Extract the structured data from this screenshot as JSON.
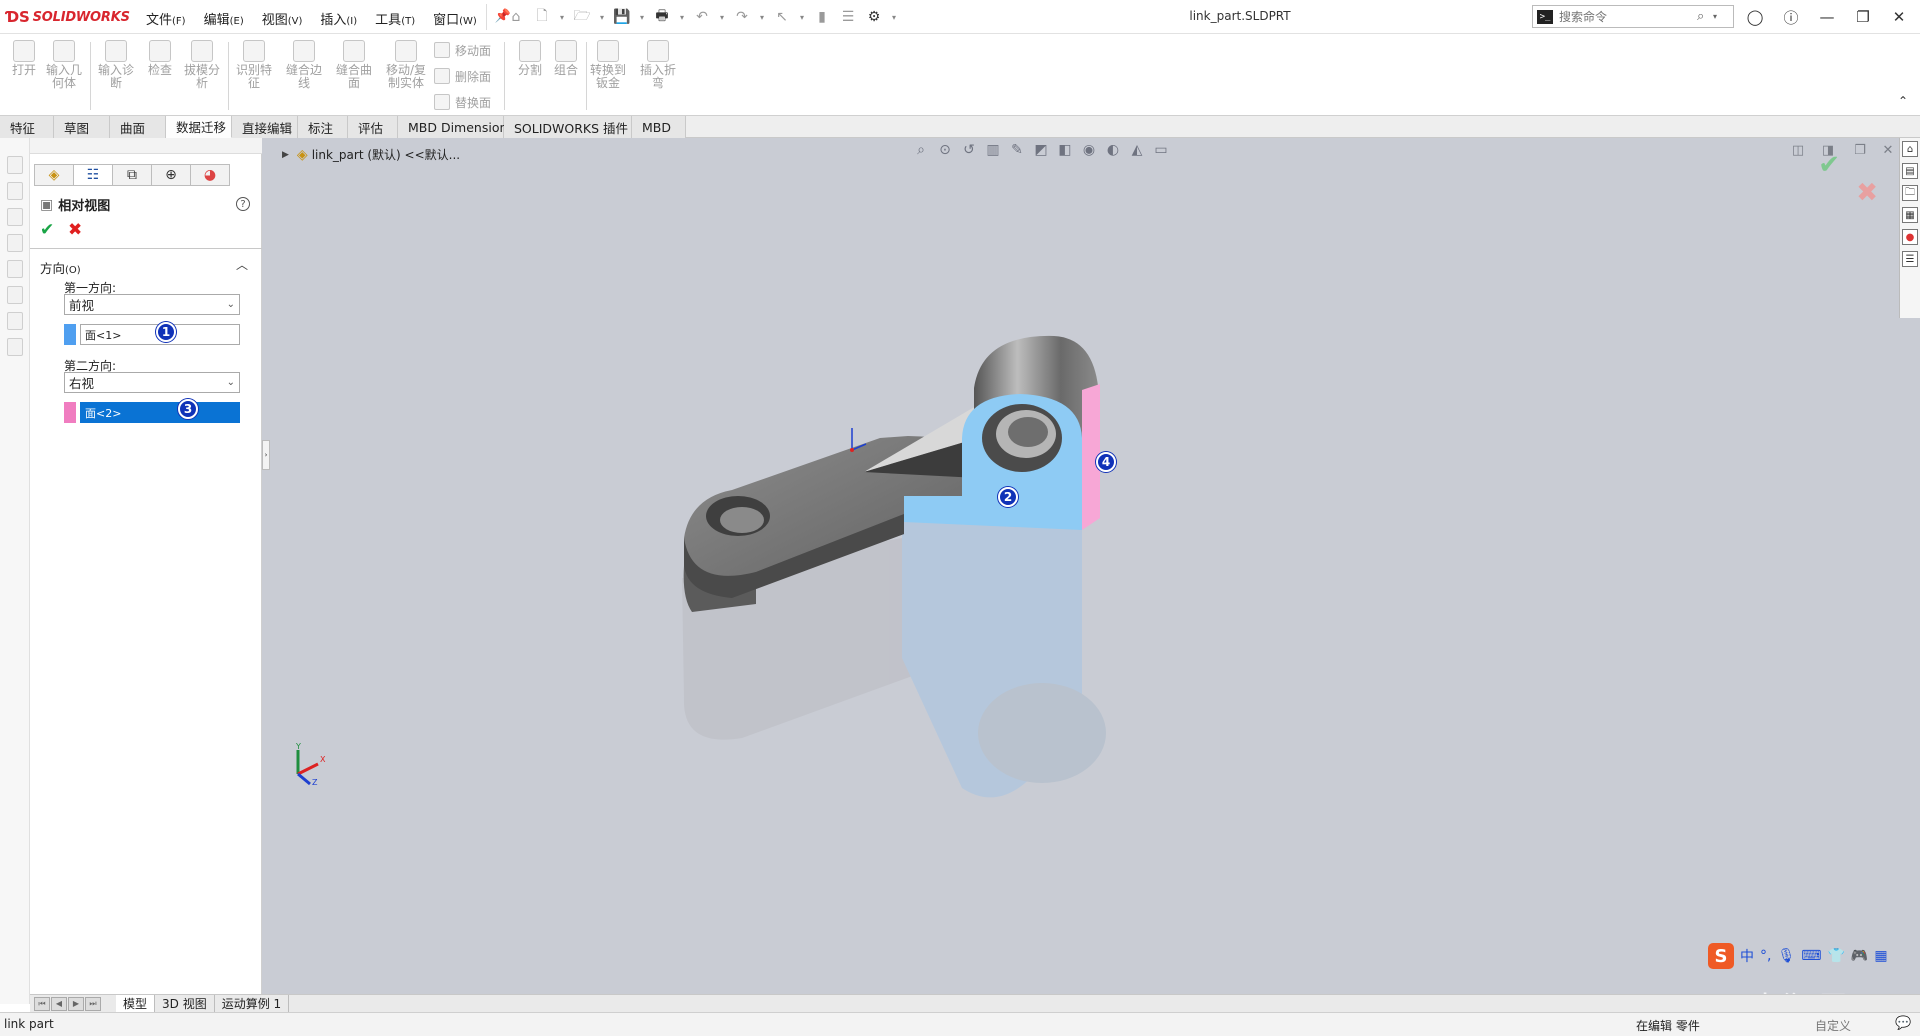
{
  "app": {
    "brand": "SOLIDWORKS",
    "document_title": "link_part.SLDPRT"
  },
  "menu": [
    {
      "label": "文件",
      "key": "(F)"
    },
    {
      "label": "编辑",
      "key": "(E)"
    },
    {
      "label": "视图",
      "key": "(V)"
    },
    {
      "label": "插入",
      "key": "(I)"
    },
    {
      "label": "工具",
      "key": "(T)"
    },
    {
      "label": "窗口",
      "key": "(W)"
    }
  ],
  "search": {
    "placeholder": "搜索命令"
  },
  "ribbon": {
    "open": "打开",
    "import_geometry": "输入几何体",
    "import_diagnostics": "输入诊断",
    "check": "检查",
    "draft_analysis": "拔模分析",
    "recognize_features": "识别特征",
    "knit_edges": "缝合边线",
    "knit_surface": "缝合曲面",
    "move_copy_body": "移动/复制实体",
    "move_face": "移动面",
    "delete_face": "删除面",
    "replace_face": "替换面",
    "split": "分割",
    "combine": "组合",
    "convert_to_sheet_metal": "转换到钣金",
    "insert_bends": "插入折弯"
  },
  "tabs": [
    "特征",
    "草图",
    "曲面",
    "数据迁移",
    "直接编辑",
    "标注",
    "评估",
    "MBD Dimensions",
    "SOLIDWORKS 插件",
    "MBD"
  ],
  "active_tab": "数据迁移",
  "property_manager": {
    "title": "相对视图",
    "help": "?",
    "section_title": "方向",
    "section_key": "(O)",
    "first_direction_label": "第一方向:",
    "first_direction_value": "前视",
    "first_face": "面<1>",
    "second_direction_label": "第二方向:",
    "second_direction_value": "右视",
    "second_face": "面<2>",
    "face1_color": "#4f9ff0",
    "face2_color": "#f07dc0"
  },
  "callouts": [
    "1",
    "2",
    "3",
    "4"
  ],
  "feature_tree": {
    "label": "link_part (默认) <<默认..."
  },
  "triad": {
    "x": "X",
    "y": "Y",
    "z": "Z"
  },
  "model_colors": {
    "body": "#6a6a6a",
    "face1": "#8ecbf4",
    "face2": "#f7a7d6",
    "viewport_bg": "#c9ccd4"
  },
  "ime": {
    "logo": "S",
    "lang": "中",
    "punct": "°,"
  },
  "watermark": "CSDN @山涧果子",
  "bottom_tabs": [
    "模型",
    "3D 视图",
    "运动算例 1"
  ],
  "status": {
    "left": "link part",
    "right": "在编辑 零件",
    "custom": "自定义"
  }
}
